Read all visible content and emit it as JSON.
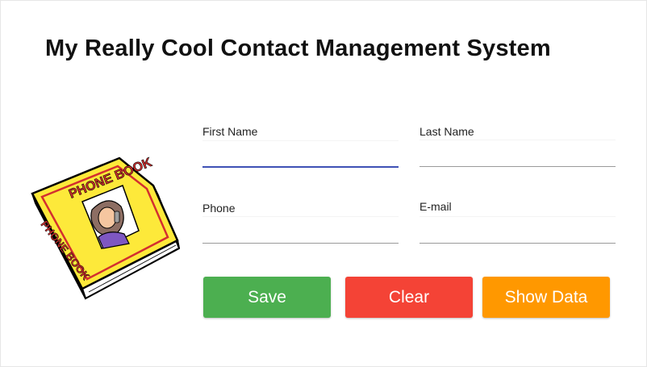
{
  "header": {
    "title": "My Really Cool Contact Management System"
  },
  "image": {
    "name": "phone-book-illustration",
    "text": "PHONE BOOK"
  },
  "form": {
    "first_name": {
      "label": "First Name",
      "value": ""
    },
    "last_name": {
      "label": "Last Name",
      "value": ""
    },
    "phone": {
      "label": "Phone",
      "value": ""
    },
    "email": {
      "label": "E-mail",
      "value": ""
    }
  },
  "buttons": {
    "save": {
      "label": "Save",
      "color": "#4caf50"
    },
    "clear": {
      "label": "Clear",
      "color": "#f44336"
    },
    "show": {
      "label": "Show Data",
      "color": "#ff9800"
    }
  },
  "colors": {
    "focus_underline": "#3f51b5"
  }
}
